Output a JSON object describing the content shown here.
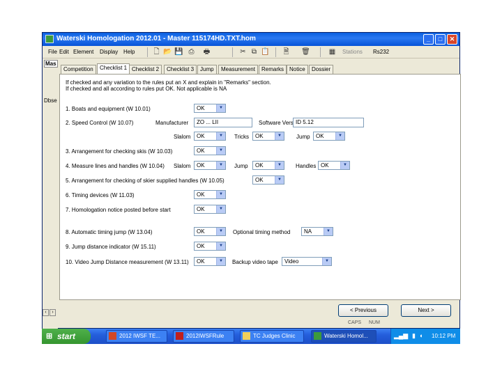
{
  "window": {
    "title": "Waterski Homologation 2012.01 - Master 115174HD.TXT.hom"
  },
  "menu": [
    "File",
    "Edit",
    "Element",
    "Display",
    "Help"
  ],
  "toolbar": {
    "stations_label": "Stations",
    "rs_label": "Rs232"
  },
  "left_strip": {
    "top_label": "Mas",
    "mid_label": "Dbse"
  },
  "tabs": [
    "Competition",
    "Checklist 1",
    "Checklist 2",
    "Checklist 3",
    "Jump",
    "Measurement",
    "Remarks",
    "Notice",
    "Dossier"
  ],
  "active_tab": "Checklist 1",
  "instructions": {
    "line1": "If checked and any variation to the rules put an X and explain in \"Remarks\" section.",
    "line2": "If checked and all according to rules put OK. Not applicable is NA"
  },
  "items": {
    "i1": {
      "label": "1. Boats and equipment (W 10.01)",
      "value": "OK"
    },
    "i2": {
      "label": "2. Speed Control (W 10.07)",
      "manufacturer_label": "Manufacturer",
      "manufacturer_value": "ZO ... LII",
      "software_label": "Software Version",
      "software_value": "ID 5.12",
      "slalom_label": "Slalom",
      "slalom_value": "OK",
      "tricks_label": "Tricks",
      "tricks_value": "OK",
      "jump_label": "Jump",
      "jump_value": "OK"
    },
    "i3": {
      "label": "3. Arrangement for checking skis (W 10.03)",
      "value": "OK"
    },
    "i4": {
      "label": "4. Measure lines and handles (W 10.04)",
      "slalom_label": "Slalom",
      "slalom_value": "OK",
      "jump_label": "Jump",
      "jump_value": "OK",
      "handles_label": "Handles",
      "handles_value": "OK"
    },
    "i5": {
      "label": "5. Arrangement for checking of skier supplied handles (W 10.05)",
      "value": "OK"
    },
    "i6": {
      "label": "6. Timing devices (W 11.03)",
      "value": "OK"
    },
    "i7": {
      "label": "7. Homologation notice posted before start",
      "value": "OK"
    },
    "i8": {
      "label": "8. Automatic timing jump (W 13.04)",
      "value": "OK",
      "optional_label": "Optional timing method",
      "optional_value": "NA"
    },
    "i9": {
      "label": "9. Jump distance indicator (W 15.11)",
      "value": "OK"
    },
    "i10": {
      "label": "10. Video Jump Distance measurement (W 13.11)",
      "value": "OK",
      "backup_label": "Backup video tape",
      "backup_value": "Video"
    }
  },
  "buttons": {
    "previous": "< Previous",
    "next": "Next >"
  },
  "status": {
    "caps": "CAPS",
    "num": "NUM"
  },
  "taskbar": {
    "start": "start",
    "tasks": [
      "2012 IWSF TE...",
      "2012IWSFRule",
      "TC Judges Clinic",
      "Waterski Homol..."
    ],
    "clock": "10:12 PM"
  }
}
